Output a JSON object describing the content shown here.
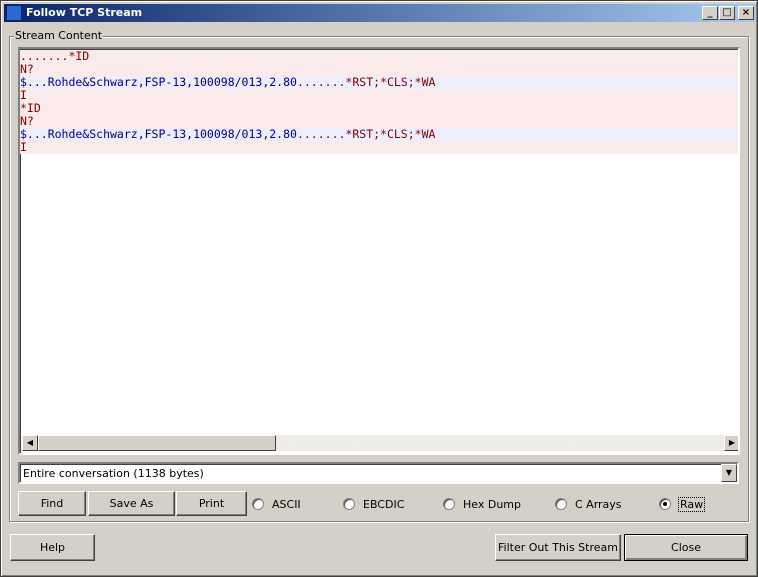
{
  "window": {
    "title": "Follow TCP Stream",
    "minimize_label": "_",
    "maximize_label": "□",
    "close_label": "×"
  },
  "stream": {
    "group_label": "Stream Content",
    "lines": [
      {
        "dir": "client",
        "text": ".......*ID"
      },
      {
        "dir": "client",
        "text": "N?"
      },
      {
        "dir": "server",
        "text": "$...Rohde&Schwarz,FSP-13,100098/013,2.80"
      },
      {
        "dir": "client",
        "text": "I"
      },
      {
        "dir": "client",
        "text": "*ID"
      },
      {
        "dir": "client",
        "text": "N?"
      },
      {
        "dir": "server",
        "text": "$...Rohde&Schwarz,FSP-13,100098/013,2.80"
      },
      {
        "dir": "client",
        "text": "I"
      }
    ],
    "server_suffix": ".......*RST;*CLS;*WA"
  },
  "conversation": {
    "selected": "Entire conversation (1138 bytes)"
  },
  "buttons": {
    "find": "Find",
    "save_as": "Save As",
    "print": "Print",
    "help": "Help",
    "filter_out": "Filter Out This Stream",
    "close": "Close"
  },
  "format": {
    "options": [
      "ASCII",
      "EBCDIC",
      "Hex Dump",
      "C Arrays",
      "Raw"
    ],
    "selected": "Raw"
  },
  "colors": {
    "client_bg": "#fbeaea",
    "client_fg": "#800000",
    "server_bg": "#ededfb",
    "server_fg": "#000080",
    "titlebar": "#0a246a"
  }
}
